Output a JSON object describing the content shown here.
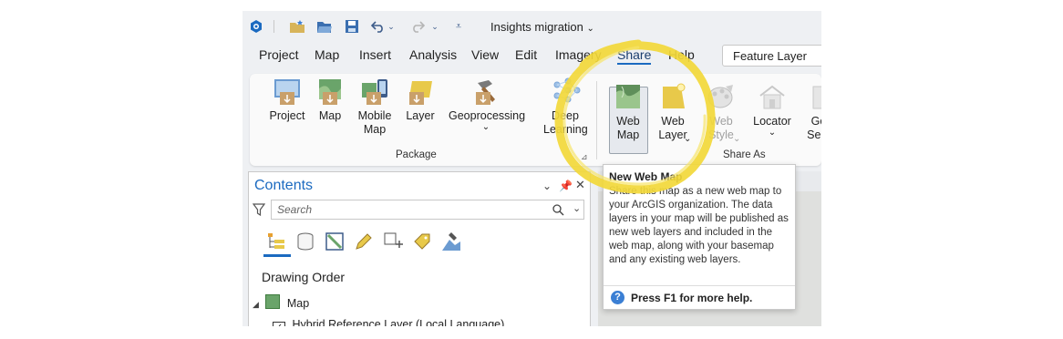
{
  "app": {
    "title": "Insights migration",
    "layer_context": "Feature Layer"
  },
  "menu_tabs": [
    "Project",
    "Map",
    "Insert",
    "Analysis",
    "View",
    "Edit",
    "Imagery",
    "Share",
    "Help"
  ],
  "active_tab": "Share",
  "ribbon": {
    "package_group": {
      "label": "Package",
      "buttons": [
        "Project",
        "Map",
        "Mobile\nMap",
        "Layer",
        "Geoprocessing",
        "Deep\nLearning"
      ]
    },
    "share_as_group": {
      "label": "Share As",
      "buttons": [
        "Web\nMap",
        "Web\nLayer",
        "Web\nStyle",
        "Locator",
        "Ge\nServ"
      ]
    }
  },
  "tooltip": {
    "title": "New Web Map",
    "body": "Share this map as a new web map to your ArcGIS organization. The data layers in your map will be published as new web layers and included in the web map, along with your basemap and any existing web layers.",
    "footer": "Press F1 for more help."
  },
  "contents": {
    "title": "Contents",
    "search_placeholder": "Search",
    "section_title": "Drawing Order",
    "map_label": "Map",
    "layer_label": "Hybrid Reference Layer (Local Language)"
  },
  "colors": {
    "accent_blue": "#1b6ac0",
    "highlight_circle": "#f2d83a"
  }
}
